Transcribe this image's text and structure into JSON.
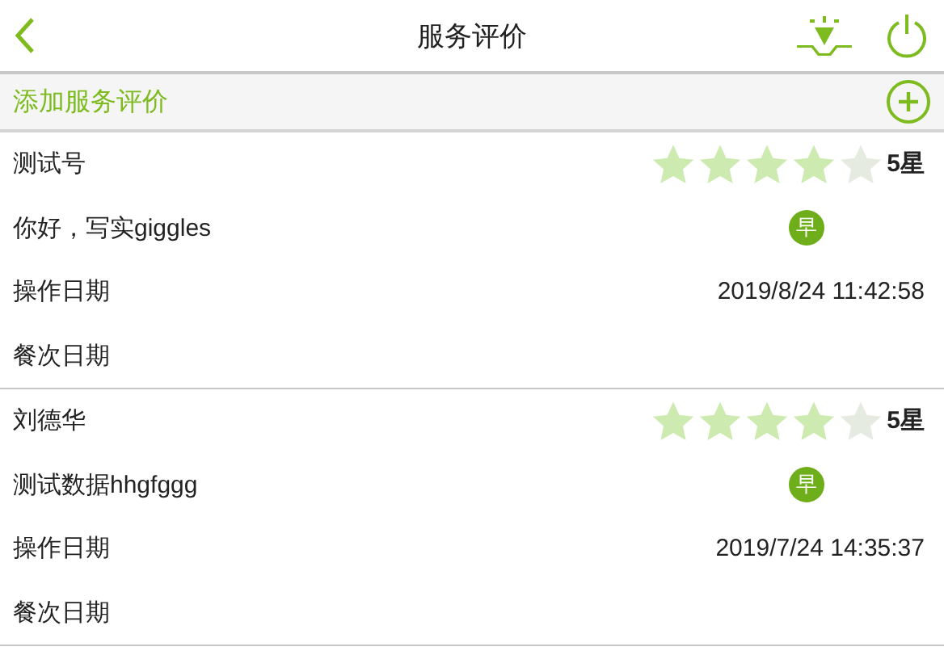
{
  "header": {
    "title": "服务评价"
  },
  "add_bar": {
    "label": "添加服务评价"
  },
  "reviews": [
    {
      "name": "测试号",
      "stars": 4,
      "rating": "5星",
      "comment": "你好，写实giggles",
      "meal_badge": "早",
      "op_label": "操作日期",
      "op_date": "2019/8/24 11:42:58",
      "meal_label": "餐次日期"
    },
    {
      "name": "刘德华",
      "stars": 4,
      "rating": "5星",
      "comment": "测试数据hhgfggg",
      "meal_badge": "早",
      "op_label": "操作日期",
      "op_date": "2019/7/24 14:35:37",
      "meal_label": "餐次日期"
    }
  ]
}
